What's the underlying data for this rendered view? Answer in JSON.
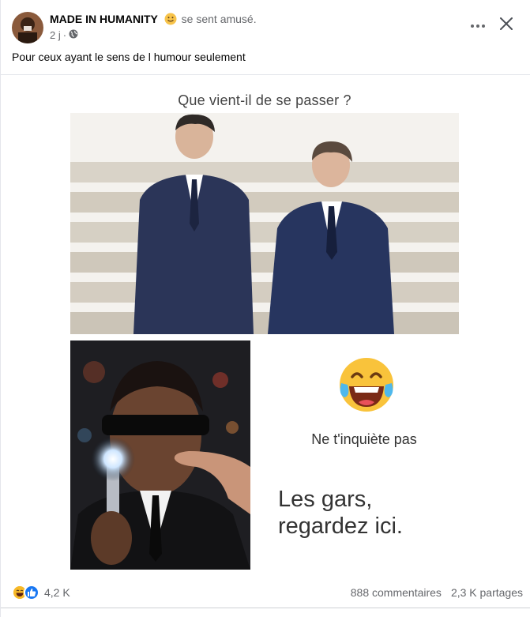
{
  "post": {
    "author": "MADE IN HUMANITY",
    "feeling": "se sent amusé.",
    "time": "2 j",
    "separator": "·",
    "text": "Pour ceux ayant le sens de l humour seulement"
  },
  "image": {
    "caption_top": "Que vient-il de se passer ?",
    "caption_middle": "Ne t'inquiète pas",
    "caption_bottom_line1": "Les gars,",
    "caption_bottom_line2": "regardez ici."
  },
  "footer": {
    "reactions_count": "4,2 K",
    "comments": "888 commentaires",
    "shares": "2,3 K partages"
  },
  "icons": {
    "feeling": "slightly-smiling-emoji-icon",
    "privacy": "globe-icon",
    "more": "more-horizontal-icon",
    "close": "close-icon",
    "reaction_1": "haha-reaction-icon",
    "reaction_2": "like-reaction-icon"
  },
  "colors": {
    "secondary_text": "#65676b",
    "like_blue": "#1877f2",
    "haha_yellow": "#f7b928"
  }
}
